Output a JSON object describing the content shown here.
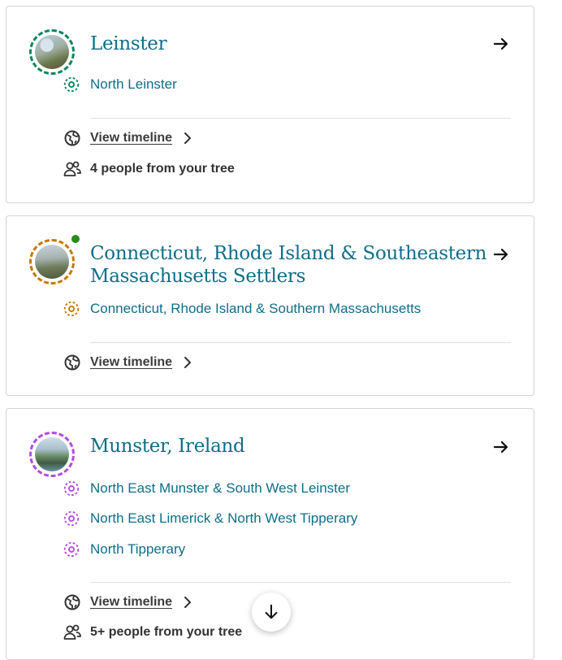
{
  "cards": [
    {
      "title": "Leinster",
      "accent": "#00875a",
      "regions": [
        "North Leinster"
      ],
      "timeline_label": "View timeline",
      "people_label": "4 people from your tree"
    },
    {
      "title_line1": "Connecticut, Rhode Island & Southeastern",
      "title_line2": "Massachusetts Settlers",
      "accent": "#c77700",
      "regions": [
        "Connecticut, Rhode Island & Southern Massachusetts"
      ],
      "timeline_label": "View timeline"
    },
    {
      "title": "Munster, Ireland",
      "accent": "#b24be5",
      "regions": [
        "North East Munster & South West Leinster",
        "North East Limerick & North West Tipperary",
        "North Tipperary"
      ],
      "timeline_label": "View timeline",
      "people_label": "5+ people from your tree"
    }
  ],
  "icons": {
    "go": "arrow-right-icon",
    "region": "region-target-icon",
    "timeline": "globe-icon",
    "people": "people-icon",
    "chevron": "chevron-right-icon",
    "scroll": "arrow-down-icon"
  }
}
